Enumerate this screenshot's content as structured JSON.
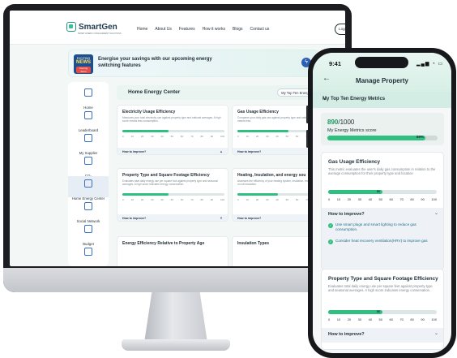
{
  "desktop": {
    "brand": "SmartGen",
    "brand_tagline": "SMART ENERGY MANAGEMENT SOLUTIONS",
    "nav": [
      "Home",
      "About Us",
      "Features",
      "How it works",
      "Blogs",
      "Contact us"
    ],
    "logout": "Logout",
    "banner": {
      "badge_top": "EXCITING",
      "badge_main": "NEWS",
      "badge_bottom": "Coming Soon",
      "text": "Energise your savings with our upcoming energy switching features"
    },
    "sidebar": [
      {
        "label": "Home",
        "icon": "home-icon"
      },
      {
        "label": "Leaderboard",
        "icon": "leaderboard-icon"
      },
      {
        "label": "My Supplier",
        "icon": "supplier-icon"
      },
      {
        "label": "CO₂",
        "icon": "co2-icon"
      },
      {
        "label": "Home Energy Center",
        "icon": "energy-center-icon",
        "active": true
      },
      {
        "label": "Social Network",
        "icon": "social-network-icon"
      },
      {
        "label": "Budget",
        "icon": "budget-icon"
      },
      {
        "label": "",
        "icon": "more-icon"
      }
    ],
    "section_title": "Home Energy Center",
    "top_ten_button": "My Top Ten Energy",
    "cards": [
      {
        "title": "Electricity Usage Efficiency",
        "desc": "Measures your total electricity use against property type and national averages. A high score means less consumption.",
        "fill": 0.45,
        "how": "How to improve?"
      },
      {
        "title": "Gas Usage Efficiency",
        "desc": "Compares your daily gas use against property type and national averages. A high score means less.",
        "fill": 0.5,
        "how": "How to improve?"
      },
      {
        "title": "Property Type and Square Footage Efficiency",
        "desc": "Evaluates total daily energy use per square foot against property type and seasonal averages. A high score indicates energy conservation.",
        "fill": 0.45,
        "how": "How to improve?"
      },
      {
        "title": "Heating, Insulation, and energy sou",
        "desc": "Assesses the efficiency of your heating system, insulation, energy sources, with a focus on loft insulation.",
        "fill": 0.4,
        "how": "How to improve?"
      },
      {
        "title": "Energy Efficiency Relative to Property Age",
        "desc": "",
        "fill": 0,
        "how": ""
      },
      {
        "title": "Insulation Types",
        "desc": "",
        "fill": 0,
        "how": ""
      }
    ],
    "ticks": [
      "0",
      "10",
      "20",
      "30",
      "40",
      "50",
      "60",
      "70",
      "80",
      "90",
      "100"
    ]
  },
  "phone": {
    "time": "9:41",
    "status": "▂▄▆ ◔ ▭",
    "back": "←",
    "title": "Manage Property",
    "sub_title": "My Top Ten Energy Metrics",
    "sub_chevron": "⌄",
    "score": {
      "value": "890",
      "total": "/1000",
      "label": "My Energy Metrics score",
      "percent": 0.89,
      "percent_label": "89%"
    },
    "cards": [
      {
        "title": "Gas Usage Efficiency",
        "desc": "This metric evaluates the user's daily gas consumption in relation to the average consumption for their property type and location",
        "fill": 0.5,
        "bar_value": "50",
        "ticks": [
          "0",
          "10",
          "20",
          "30",
          "40",
          "50",
          "60",
          "70",
          "80",
          "90",
          "100"
        ],
        "how": "How to improve?",
        "tips": [
          "Use smart plugs and smart lighting to reduce gas consumption.",
          "Consider heat recovery ventilation(HRV) to improve gas"
        ]
      },
      {
        "title": "Property Type and Square Footage Efficiency",
        "desc": "Evaluates total daily energy use per square feet against property type and seasonal averages. A high score indicates energy conservation.",
        "fill": 0.5,
        "bar_value": "50",
        "ticks": [
          "0",
          "10",
          "20",
          "30",
          "40",
          "50",
          "60",
          "70",
          "80",
          "90",
          "100"
        ],
        "how": "How to improve?",
        "tips": []
      }
    ]
  },
  "colors": {
    "accent": "#2fbf80",
    "brand": "#1f3b4d",
    "link": "#1f6e8c"
  }
}
